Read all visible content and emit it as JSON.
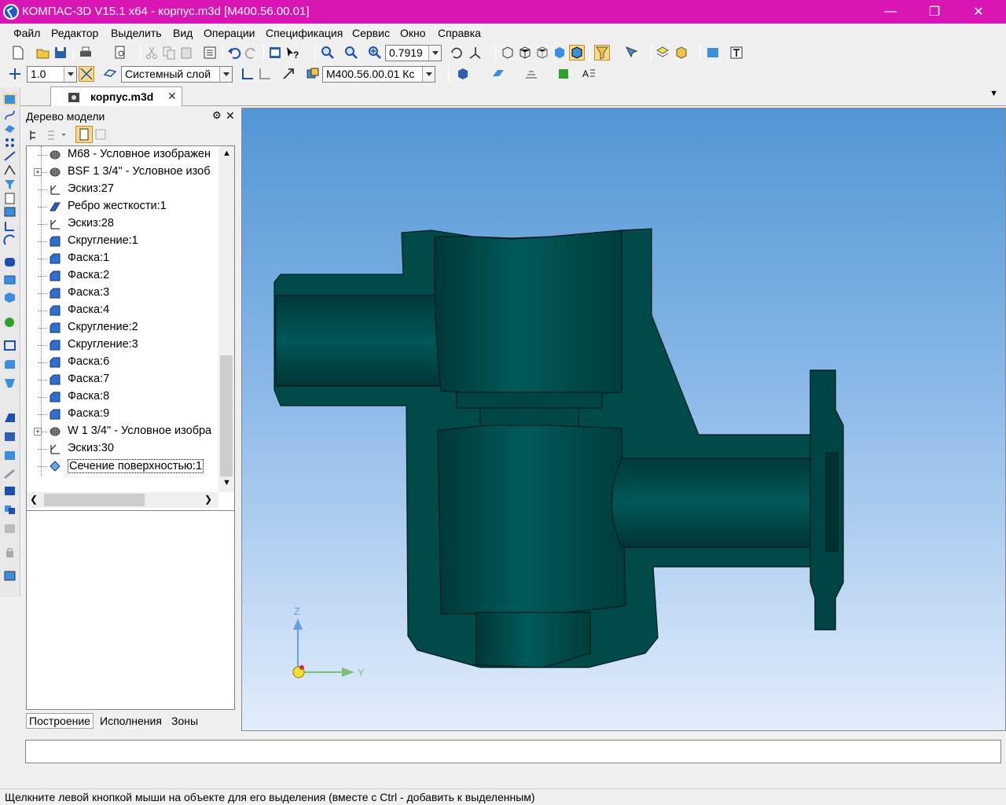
{
  "window": {
    "title": "КОМПАС-3D V15.1 x64 - корпус.m3d [M400.56.00.01]"
  },
  "menu": [
    "Файл",
    "Редактор",
    "Выделить",
    "Вид",
    "Операции",
    "Спецификация",
    "Сервис",
    "Окно",
    "Справка"
  ],
  "toolbar": {
    "zoom_value": "0.7919",
    "step_value": "1.0",
    "layer_value": "Системный слой",
    "designation_value": "M400.56.00.01 Кс"
  },
  "doc_tab": {
    "label": "корпус.m3d"
  },
  "tree_panel": {
    "title": "Дерево модели",
    "items": [
      {
        "label": "M68 - Условное изображен",
        "icon": "thread-icon",
        "expand": false
      },
      {
        "label": "BSF 1 3/4\" - Условное изоб",
        "icon": "thread-icon",
        "expand": true
      },
      {
        "label": "Эскиз:27",
        "icon": "sketch-icon",
        "expand": false
      },
      {
        "label": "Ребро жесткости:1",
        "icon": "rib-icon",
        "expand": false
      },
      {
        "label": "Эскиз:28",
        "icon": "sketch-icon",
        "expand": false
      },
      {
        "label": "Скругление:1",
        "icon": "fillet-icon",
        "expand": false
      },
      {
        "label": "Фаска:1",
        "icon": "chamfer-icon",
        "expand": false
      },
      {
        "label": "Фаска:2",
        "icon": "chamfer-icon",
        "expand": false
      },
      {
        "label": "Фаска:3",
        "icon": "chamfer-icon",
        "expand": false
      },
      {
        "label": "Фаска:4",
        "icon": "chamfer-icon",
        "expand": false
      },
      {
        "label": "Скругление:2",
        "icon": "fillet-icon",
        "expand": false
      },
      {
        "label": "Скругление:3",
        "icon": "fillet-icon",
        "expand": false
      },
      {
        "label": "Фаска:6",
        "icon": "chamfer-icon",
        "expand": false
      },
      {
        "label": "Фаска:7",
        "icon": "chamfer-icon",
        "expand": false
      },
      {
        "label": "Фаска:8",
        "icon": "chamfer-icon",
        "expand": false
      },
      {
        "label": "Фаска:9",
        "icon": "chamfer-icon",
        "expand": false
      },
      {
        "label": "W 1 3/4\" - Условное изобра",
        "icon": "thread-icon",
        "expand": true
      },
      {
        "label": "Эскиз:30",
        "icon": "sketch-icon",
        "expand": false
      },
      {
        "label": "Сечение поверхностью:1",
        "icon": "section-icon",
        "expand": false
      }
    ],
    "bottom_tabs": [
      "Построение",
      "Исполнения",
      "Зоны"
    ]
  },
  "axes": {
    "z_label": "Z",
    "y_label": "Y"
  },
  "status": {
    "text": "Щелкните левой кнопкой мыши на объекте для его выделения (вместе с Ctrl - добавить к выделенным)"
  },
  "colors": {
    "title_bar": "#d915b4",
    "model_fill": "#004a4a",
    "viewport_top": "#5296d4",
    "viewport_bottom": "#e3edfb"
  }
}
